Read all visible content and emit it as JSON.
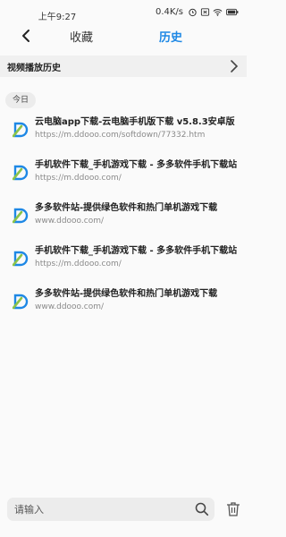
{
  "status_bar": {
    "time": "上午9:27",
    "network_speed": "0.4K/s"
  },
  "top_nav": {
    "tabs": [
      {
        "label": "收藏",
        "active": false
      },
      {
        "label": "历史",
        "active": true
      }
    ]
  },
  "video_history": {
    "title": "视频播放历史"
  },
  "history": {
    "date_label": "今日",
    "items": [
      {
        "title": "云电脑app下载-云电脑手机版下载 v5.8.3安卓版",
        "url": "https://m.ddooo.com/softdown/77332.htm"
      },
      {
        "title": "手机软件下载_手机游戏下载 - 多多软件手机下载站",
        "url": "https://m.ddooo.com/"
      },
      {
        "title": "多多软件站-提供绿色软件和热门单机游戏下载",
        "url": "www.ddooo.com/"
      },
      {
        "title": "手机软件下载_手机游戏下载 - 多多软件手机下载站",
        "url": "https://m.ddooo.com/"
      },
      {
        "title": "多多软件站-提供绿色软件和热门单机游戏下载",
        "url": "www.ddooo.com/"
      }
    ]
  },
  "search": {
    "placeholder": "请输入"
  },
  "colors": {
    "accent": "#1e88e5",
    "logo_blue": "#1e88e5",
    "logo_green": "#8bc34a"
  }
}
